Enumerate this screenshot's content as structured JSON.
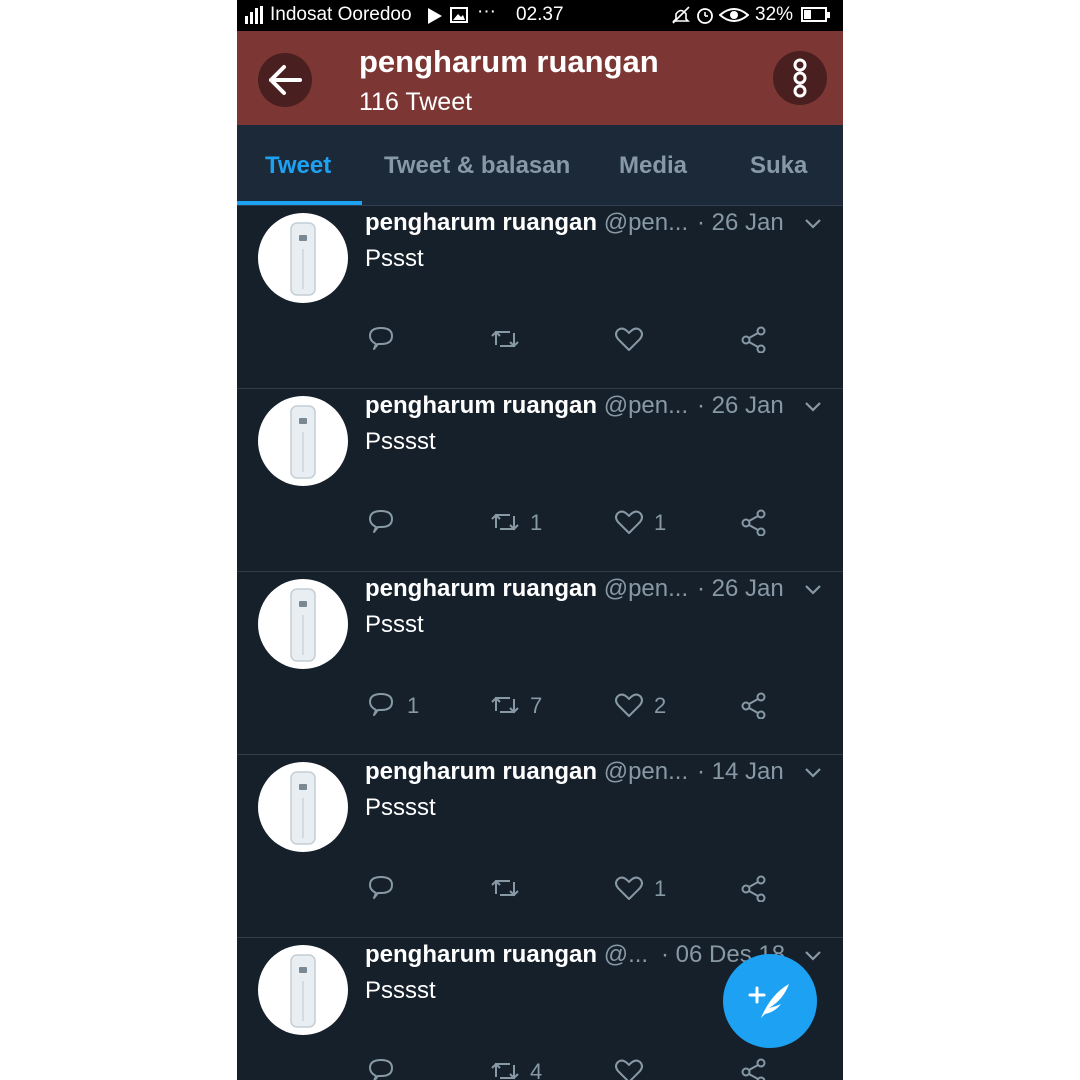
{
  "status_bar": {
    "carrier": "Indosat Ooredoo",
    "time": "02.37",
    "battery": "32%",
    "icons": [
      "signal-icon",
      "play-store-icon",
      "gallery-icon",
      "more-notifications-icon",
      "mute-icon",
      "alarm-icon",
      "eye-icon",
      "battery-icon"
    ]
  },
  "header": {
    "title": "pengharum ruangan",
    "subtitle": "116 Tweet",
    "bg_color": "#7c3735"
  },
  "tabs": [
    {
      "label": "Tweet",
      "active": true
    },
    {
      "label": "Tweet & balasan",
      "active": false
    },
    {
      "label": "Media",
      "active": false
    },
    {
      "label": "Suka",
      "active": false
    }
  ],
  "tweets": [
    {
      "name": "pengharum ruangan",
      "handle": "@pen...",
      "time": "· 26 Jan",
      "text": "Pssst",
      "replies": "",
      "retweets": "",
      "likes": ""
    },
    {
      "name": "pengharum ruangan",
      "handle": "@pen...",
      "time": "· 26 Jan",
      "text": "Psssst",
      "replies": "",
      "retweets": "1",
      "likes": "1"
    },
    {
      "name": "pengharum ruangan",
      "handle": "@pen...",
      "time": "· 26 Jan",
      "text": "Pssst",
      "replies": "1",
      "retweets": "7",
      "likes": "2"
    },
    {
      "name": "pengharum ruangan",
      "handle": "@pen...",
      "time": "· 14 Jan",
      "text": "Psssst",
      "replies": "",
      "retweets": "",
      "likes": "1"
    },
    {
      "name": "pengharum ruangan",
      "handle": "@...",
      "time": "· 06 Des 18",
      "text": "Psssst",
      "replies": "",
      "retweets": "4",
      "likes": ""
    }
  ],
  "colors": {
    "accent": "#1da1f2",
    "background": "#15202b",
    "muted": "#8899a6"
  }
}
